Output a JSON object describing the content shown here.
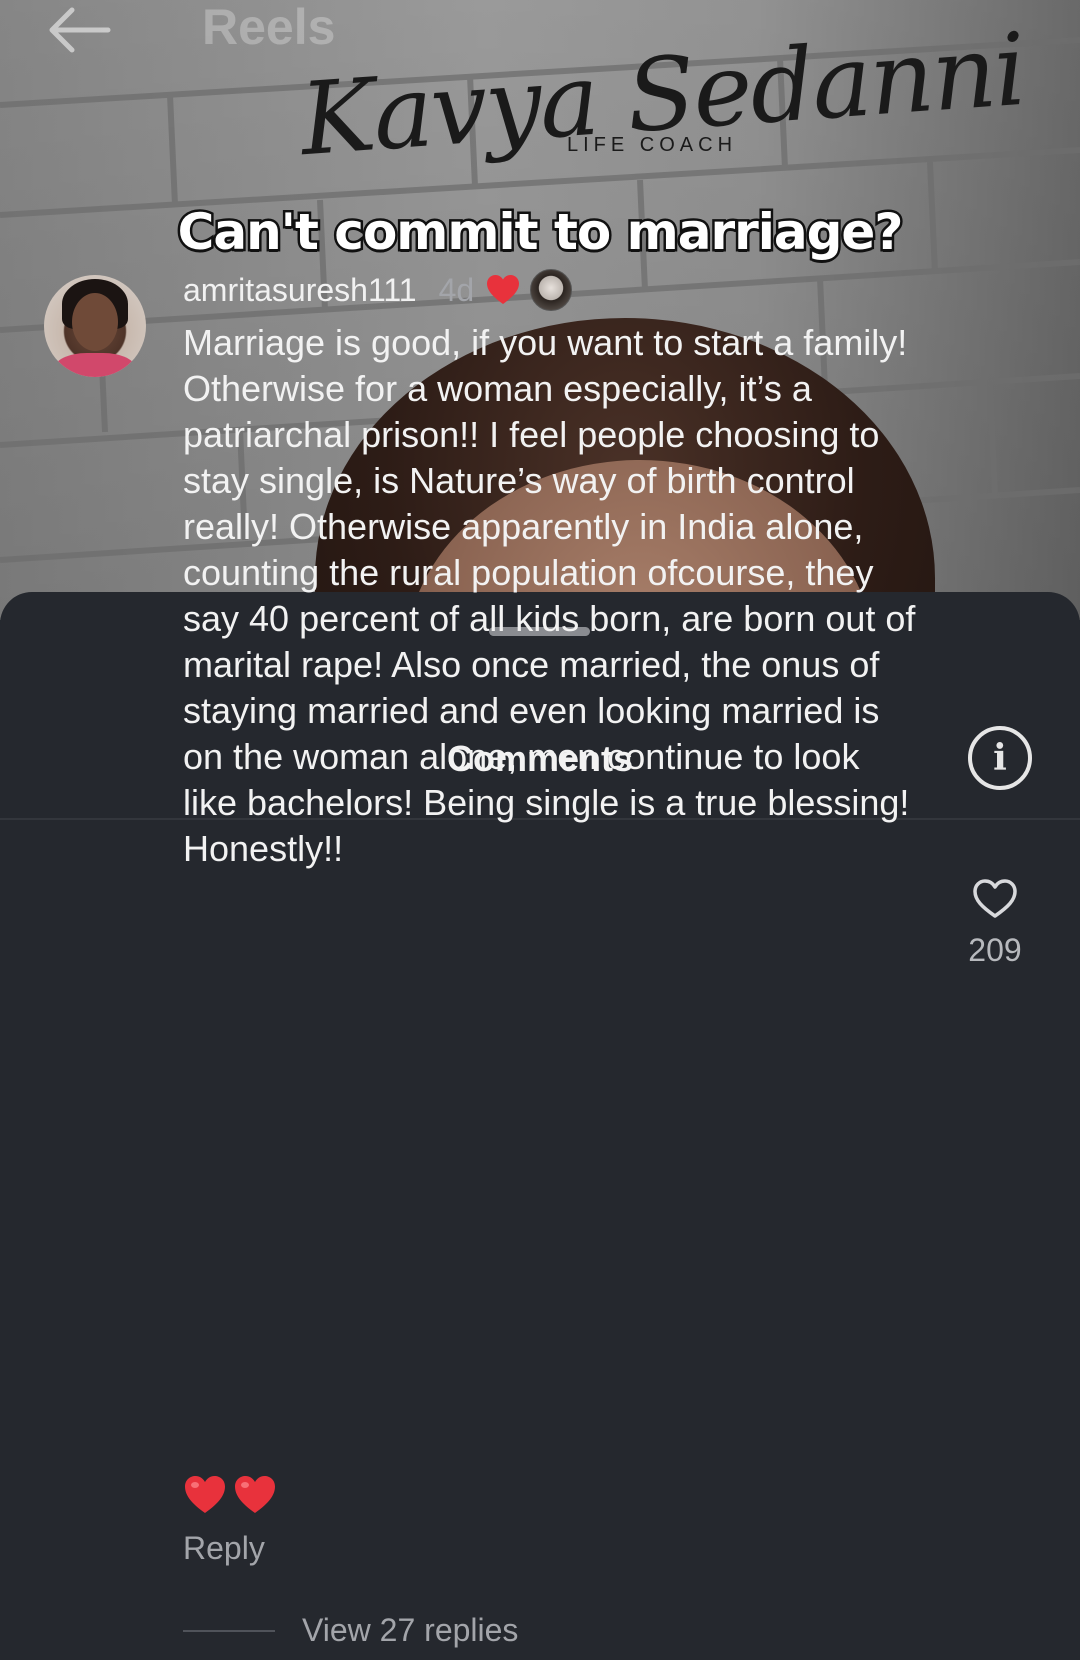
{
  "header": {
    "title": "Reels"
  },
  "video": {
    "brand_script": "Kavya Sedanni",
    "brand_subtitle": "LIFE COACH",
    "caption": "Can't commit to marriage?"
  },
  "comments_sheet": {
    "title": "Comments",
    "comment": {
      "username": "amritasuresh111",
      "time": "4d",
      "text": "Marriage is good, if you want to start a family! Otherwise for a woman especially, it’s a patriarchal prison!! I feel people choosing to stay single, is Nature’s way of birth control really! Otherwise apparently in India alone, counting the rural population ofcourse, they say 40 percent of all kids born, are born out of marital rape! Also once married, the onus of staying married and even looking married is on the woman alone, men continue to look like bachelors! Being single is a true blessing! Honestly!!",
      "emojis": [
        "❤️",
        "❤️"
      ],
      "like_count": "209",
      "reply_label": "Reply",
      "view_replies_label": "View 27 replies"
    }
  },
  "colors": {
    "sheet_background": "#25282e",
    "primary_text": "#f2f2f2",
    "secondary_text": "#a3a5aa",
    "heart_red": "#e8323c"
  },
  "icons": {
    "back": "back-arrow-icon",
    "info": "info-icon",
    "like": "heart-outline-icon",
    "creator_liked": "heart-filled-icon"
  }
}
